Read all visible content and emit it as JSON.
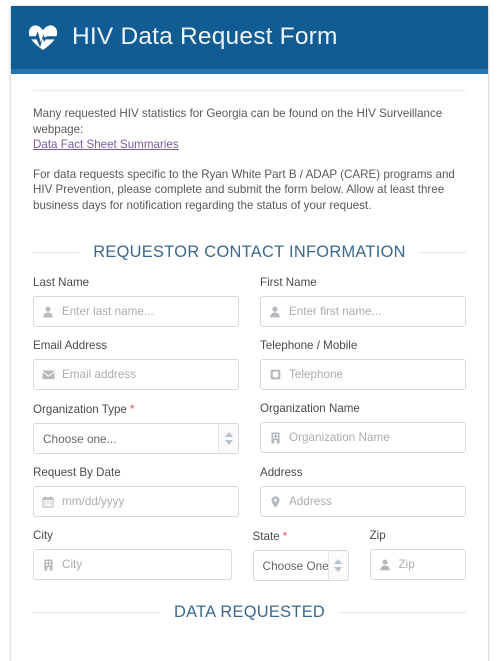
{
  "header": {
    "title": "HIV Data Request Form",
    "icon": "heartbeat-icon"
  },
  "intro": {
    "paragraph1_before_link": "Many requested HIV statistics for Georgia can be found on the HIV Surveillance webpage:",
    "link_text": "Data Fact Sheet Summaries",
    "paragraph2": "For data requests specific to the Ryan White Part B / ADAP (CARE) programs and HIV Prevention, please complete and submit the form below. Allow at least three business days for notification regarding the status of your request."
  },
  "sections": {
    "contact": "REQUESTOR CONTACT INFORMATION",
    "data_requested": "DATA REQUESTED"
  },
  "fields": {
    "last_name": {
      "label": "Last Name",
      "placeholder": "Enter last name...",
      "icon": "user-icon"
    },
    "first_name": {
      "label": "First Name",
      "placeholder": "Enter first name...",
      "icon": "user-icon"
    },
    "email": {
      "label": "Email Address",
      "placeholder": "Email address",
      "icon": "envelope-icon"
    },
    "telephone": {
      "label": "Telephone / Mobile",
      "placeholder": "Telephone",
      "icon": "phone-icon"
    },
    "org_type": {
      "label": "Organization Type",
      "required_marker": "*",
      "value": "Choose one...",
      "icon": "chevron-updown-icon"
    },
    "org_name": {
      "label": "Organization Name",
      "placeholder": "Organization Name",
      "icon": "building-icon"
    },
    "request_date": {
      "label": "Request By Date",
      "placeholder": "mm/dd/yyyy",
      "icon": "calendar-icon"
    },
    "address": {
      "label": "Address",
      "placeholder": "Address",
      "icon": "map-pin-icon"
    },
    "city": {
      "label": "City",
      "placeholder": "City",
      "icon": "building-icon"
    },
    "state": {
      "label": "State",
      "required_marker": "*",
      "value": "Choose One",
      "icon": "chevron-updown-icon"
    },
    "zip": {
      "label": "Zip",
      "placeholder": "Zip",
      "icon": "user-icon"
    }
  },
  "colors": {
    "header_blue": "#115d93",
    "header_stripe": "#2576ae",
    "section_heading": "#39688f",
    "required_red": "#e8544f",
    "link_purple": "#7a5ca0",
    "placeholder_gray": "#a9adb1",
    "border_gray": "#d6dade"
  }
}
